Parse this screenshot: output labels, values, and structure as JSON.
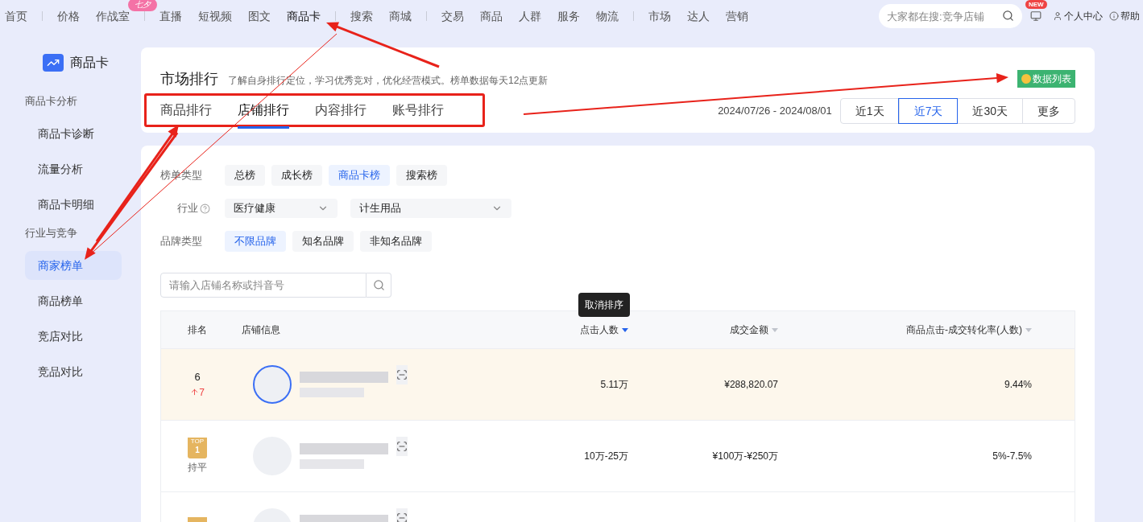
{
  "nav": {
    "groups": [
      [
        {
          "label": "首页",
          "selected": false
        }
      ],
      [
        {
          "label": "价格",
          "selected": false
        },
        {
          "label": "作战室",
          "selected": false,
          "badge": "七夕"
        }
      ],
      [
        {
          "label": "直播",
          "selected": false
        },
        {
          "label": "短视频",
          "selected": false
        },
        {
          "label": "图文",
          "selected": false
        },
        {
          "label": "商品卡",
          "selected": true
        }
      ],
      [
        {
          "label": "搜索",
          "selected": false
        },
        {
          "label": "商城",
          "selected": false
        }
      ],
      [
        {
          "label": "交易",
          "selected": false
        },
        {
          "label": "商品",
          "selected": false
        },
        {
          "label": "人群",
          "selected": false
        },
        {
          "label": "服务",
          "selected": false
        },
        {
          "label": "物流",
          "selected": false
        }
      ],
      [
        {
          "label": "市场",
          "selected": false
        },
        {
          "label": "达人",
          "selected": false
        },
        {
          "label": "营销",
          "selected": false
        }
      ]
    ],
    "search_placeholder": "大家都在搜:竞争店铺",
    "new_badge": "NEW",
    "user": "个人中心",
    "help": "帮助"
  },
  "sidebar": {
    "title": "商品卡",
    "sections": [
      {
        "label": "商品卡分析",
        "items": [
          {
            "label": "商品卡诊断",
            "selected": false
          },
          {
            "label": "流量分析",
            "selected": false
          },
          {
            "label": "商品卡明细",
            "selected": false
          }
        ]
      },
      {
        "label": "行业与竞争",
        "items": [
          {
            "label": "商家榜单",
            "selected": true
          },
          {
            "label": "商品榜单",
            "selected": false
          },
          {
            "label": "竞店对比",
            "selected": false
          },
          {
            "label": "竞品对比",
            "selected": false
          }
        ]
      }
    ]
  },
  "header": {
    "title": "市场排行",
    "subtitle": "了解自身排行定位，学习优秀竞对，优化经营模式。榜单数据每天12点更新",
    "data_list": "数据列表",
    "tabs": [
      {
        "label": "商品排行",
        "selected": false
      },
      {
        "label": "店铺排行",
        "selected": true
      },
      {
        "label": "内容排行",
        "selected": false
      },
      {
        "label": "账号排行",
        "selected": false
      }
    ],
    "date_range": "2024/07/26 - 2024/08/01",
    "ranges": [
      {
        "label": "近1天",
        "selected": false
      },
      {
        "label": "近7天",
        "selected": true
      },
      {
        "label": "近30天",
        "selected": false
      },
      {
        "label": "更多",
        "selected": false
      }
    ]
  },
  "filters": [
    {
      "kind": "chips",
      "label": "榜单类型",
      "options": [
        {
          "label": "总榜",
          "selected": false
        },
        {
          "label": "成长榜",
          "selected": false
        },
        {
          "label": "商品卡榜",
          "selected": true
        },
        {
          "label": "搜索榜",
          "selected": false
        }
      ]
    },
    {
      "kind": "selects",
      "label": "行业",
      "help": true,
      "selects": [
        "医疗健康",
        "计生用品"
      ]
    },
    {
      "kind": "chips",
      "label": "品牌类型",
      "options": [
        {
          "label": "不限品牌",
          "selected": true
        },
        {
          "label": "知名品牌",
          "selected": false
        },
        {
          "label": "非知名品牌",
          "selected": false
        }
      ]
    }
  ],
  "store_search_placeholder": "请输入店铺名称或抖音号",
  "table": {
    "tooltip": "取消排序",
    "columns": [
      {
        "label": "排名"
      },
      {
        "label": "店铺信息"
      },
      {
        "label": "点击人数",
        "sorted": true
      },
      {
        "label": "成交金额",
        "sorted": false
      },
      {
        "label": "商品点击-成交转化率(人数)",
        "sorted": false
      }
    ],
    "rows": [
      {
        "highlighted": true,
        "rank": {
          "kind": "number",
          "value": "6",
          "change": "7"
        },
        "avatar_ring": true,
        "clicks": "5.11万",
        "amount": "¥288,820.07",
        "rate": "9.44%"
      },
      {
        "highlighted": false,
        "rank": {
          "kind": "top",
          "top": "TOP",
          "value": "1",
          "change": "持平"
        },
        "avatar_ring": false,
        "clicks": "10万-25万",
        "amount": "¥100万-¥250万",
        "rate": "5%-7.5%"
      },
      {
        "highlighted": false,
        "rank": {
          "kind": "top"
        },
        "avatar_ring": false
      }
    ]
  }
}
